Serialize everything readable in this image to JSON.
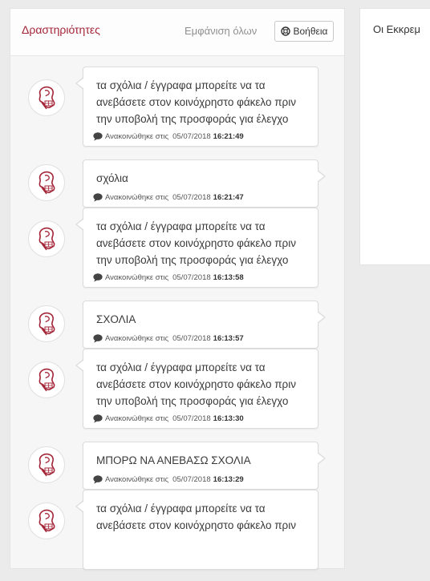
{
  "activities": {
    "title": "Δραστηριότητες",
    "show_all": "Εμφάνιση όλων",
    "help_label": "Βοήθεια",
    "posted_label": "Ανακοινώθηκε στις",
    "items": [
      {
        "text": "τα σχόλια / έγγραφα μπορείτε να τα ανεβάσετε στον κοινόχρηστο φάκελο πριν την υποβολή της προσφοράς για έλεγχο",
        "date": "05/07/2018",
        "time": "16:21:49"
      },
      {
        "text": "σχόλια",
        "date": "05/07/2018",
        "time": "16:21:47"
      },
      {
        "text": "τα σχόλια / έγγραφα μπορείτε να τα ανεβάσετε στον κοινόχρηστο φάκελο πριν την υποβολή της προσφοράς για έλεγχο",
        "date": "05/07/2018",
        "time": "16:13:58"
      },
      {
        "text": "ΣΧΟΛΙΑ",
        "date": "05/07/2018",
        "time": "16:13:57"
      },
      {
        "text": "τα σχόλια / έγγραφα μπορείτε να τα ανεβάσετε στον κοινόχρηστο φάκελο πριν την υποβολή της προσφοράς για έλεγχο",
        "date": "05/07/2018",
        "time": "16:13:30"
      },
      {
        "text": "ΜΠΟΡΩ ΝΑ ΑΝΕΒΑΣΩ ΣΧΟΛΙΑ",
        "date": "05/07/2018",
        "time": "16:13:29"
      },
      {
        "text": "τα σχόλια / έγγραφα μπορείτε να τα ανεβάσετε στον κοινόχρηστο φάκελο πριν",
        "date": "",
        "time": ""
      }
    ]
  },
  "pending": {
    "title": "Οι Εκκρεμ"
  },
  "colors": {
    "accent": "#a32537",
    "background": "#ebebeb"
  },
  "icons": {
    "help": "lifebuoy-icon",
    "comment": "comment-bubble-icon",
    "avatar": "crest-logo-icon"
  }
}
